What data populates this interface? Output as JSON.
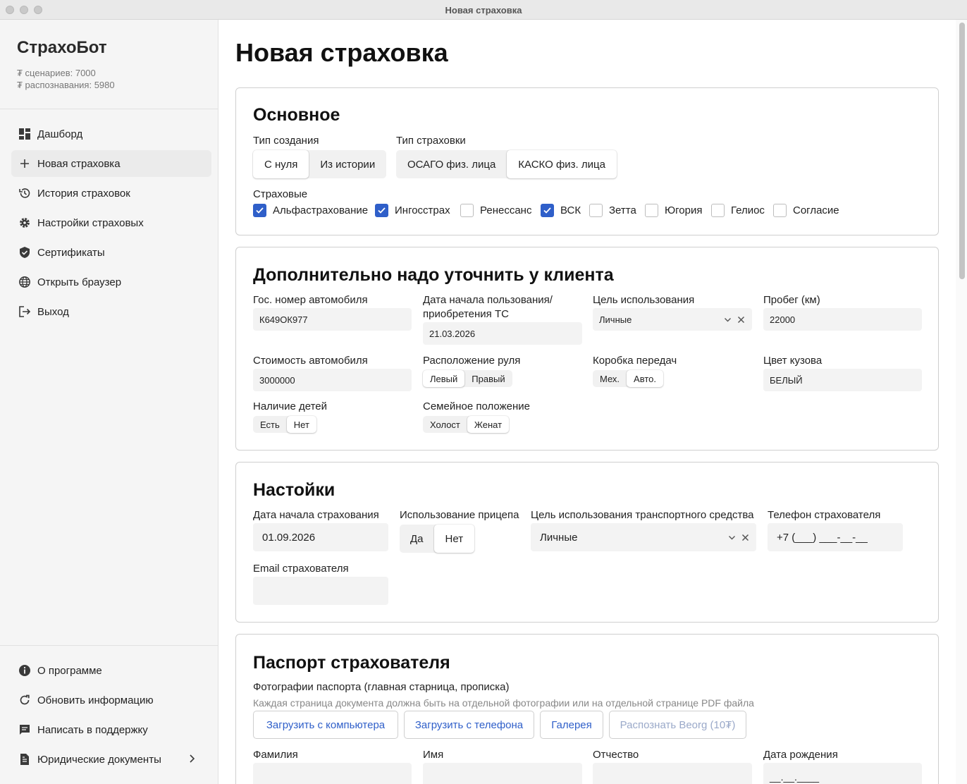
{
  "window": {
    "title": "Новая страховка"
  },
  "sidebar": {
    "brand": "СтрахоБот",
    "counters": [
      "₮ сценариев: 7000",
      "₮ распознавания: 5980"
    ],
    "nav": [
      {
        "label": "Дашборд",
        "icon": "dashboard-icon"
      },
      {
        "label": "Новая страховка",
        "icon": "plus-icon"
      },
      {
        "label": "История страховок",
        "icon": "history-icon"
      },
      {
        "label": "Настройки страховых",
        "icon": "gear-icon"
      },
      {
        "label": "Сертификаты",
        "icon": "shield-icon"
      },
      {
        "label": "Открыть браузер",
        "icon": "globe-icon"
      },
      {
        "label": "Выход",
        "icon": "logout-icon"
      }
    ],
    "bottom": [
      {
        "label": "О программе",
        "icon": "info-icon"
      },
      {
        "label": "Обновить информацию",
        "icon": "refresh-icon"
      },
      {
        "label": "Написать в поддержку",
        "icon": "chat-icon"
      },
      {
        "label": "Юридические документы",
        "icon": "document-icon"
      }
    ]
  },
  "main": {
    "title": "Новая страховка",
    "basic": {
      "title": "Основное",
      "creation_type_label": "Тип создания",
      "creation_types": [
        "С нуля",
        "Из истории"
      ],
      "insurance_type_label": "Тип страховки",
      "insurance_types": [
        "ОСАГО физ. лица",
        "КАСКО физ. лица"
      ],
      "insurers_label": "Страховые",
      "insurers": [
        {
          "name": "Альфастрахование",
          "checked": true
        },
        {
          "name": "Ингосстрах",
          "checked": true
        },
        {
          "name": "Ренессанс",
          "checked": false
        },
        {
          "name": "ВСК",
          "checked": true
        },
        {
          "name": "Зетта",
          "checked": false
        },
        {
          "name": "Югория",
          "checked": false
        },
        {
          "name": "Гелиос",
          "checked": false
        },
        {
          "name": "Согласие",
          "checked": false
        }
      ]
    },
    "extra": {
      "title": "Дополнительно надо уточнить у клиента",
      "plate_label": "Гос. номер автомобиля",
      "plate_value": "К649ОК977",
      "start_use_label_1": "Дата начала пользования/",
      "start_use_label_2": "приобретения ТС",
      "start_use_value": "21.03.2026",
      "purpose_label": "Цель использования",
      "purpose_value": "Личные",
      "mileage_label": "Пробег (км)",
      "mileage_value": "22000",
      "cost_label": "Стоимость автомобиля",
      "cost_value": "3000000",
      "wheel_label": "Расположение руля",
      "wheel_options": [
        "Левый",
        "Правый"
      ],
      "gearbox_label": "Коробка передач",
      "gearbox_options": [
        "Мех.",
        "Авто."
      ],
      "color_label": "Цвет кузова",
      "color_value": "БЕЛЫЙ",
      "children_label": "Наличие детей",
      "children_options": [
        "Есть",
        "Нет"
      ],
      "marital_label": "Семейное положение",
      "marital_options": [
        "Холост",
        "Женат"
      ]
    },
    "settings": {
      "title": "Настойки",
      "start_date_label": "Дата начала страхования",
      "start_date_value": "01.09.2026",
      "trailer_label": "Использование прицепа",
      "trailer_options": [
        "Да",
        "Нет"
      ],
      "vehicle_purpose_label": "Цель использования транспортного средства",
      "vehicle_purpose_value": "Личные",
      "phone_label": "Телефон страхователя",
      "phone_value": "+7 (___) ___-__-__",
      "email_label": "Email страхователя",
      "email_value": ""
    },
    "passport": {
      "title": "Паспорт страхователя",
      "photos_label": "Фотографии паспорта (главная старница, прописка)",
      "photos_hint": "Каждая страница документа должна быть на отдельной фотографии или на отдельной странице PDF файла",
      "buttons": [
        "Загрузить с компьютера",
        "Загрузить с телефона",
        "Галерея",
        "Распознать Beorg (10₮)"
      ],
      "surname_label": "Фамилия",
      "name_label": "Имя",
      "patronymic_label": "Отчество",
      "birth_label": "Дата рождения",
      "birth_value": "__.__.____"
    }
  },
  "colors": {
    "accent": "#2f5fc9",
    "border": "#cfcfcf",
    "field_bg": "#f3f3f3"
  }
}
